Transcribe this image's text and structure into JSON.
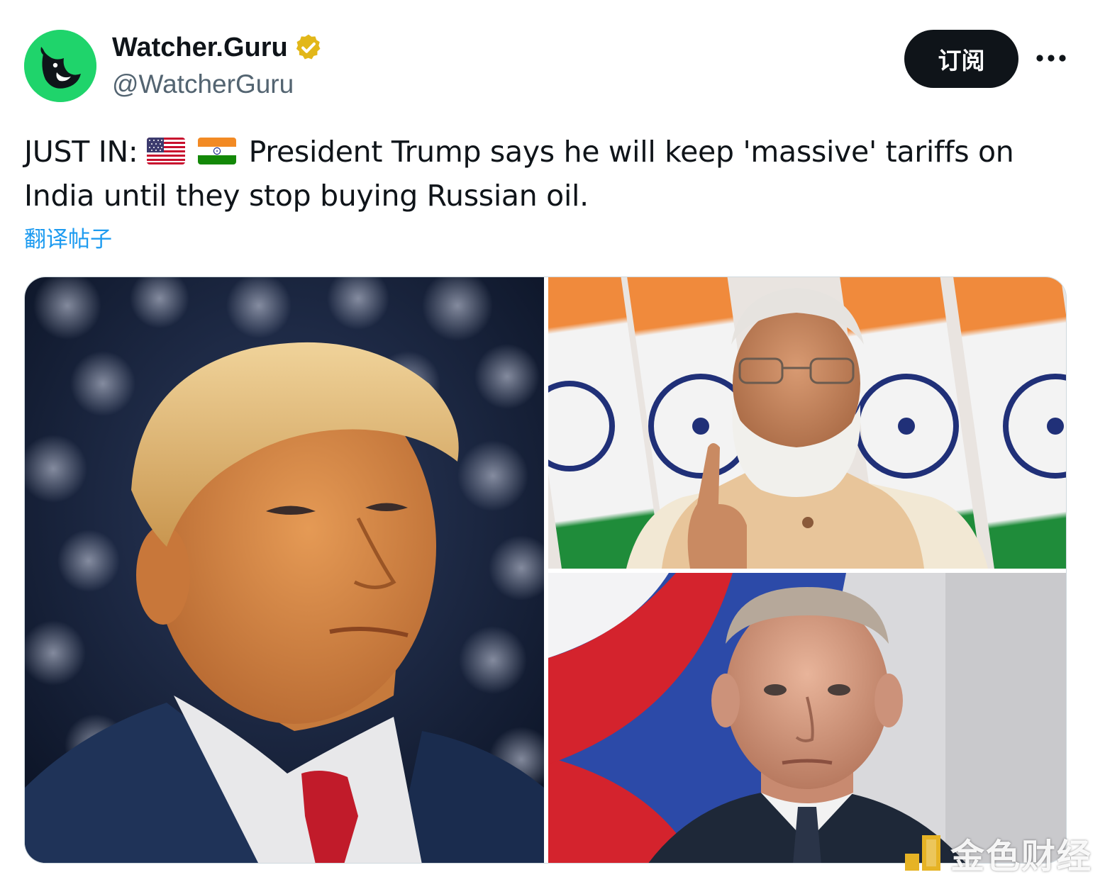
{
  "author": {
    "display_name": "Watcher.Guru",
    "handle": "@WatcherGuru",
    "verified": true,
    "avatar_icon": "whale-logo-icon",
    "avatar_color": "#1fd46b"
  },
  "actions": {
    "subscribe_label": "订阅",
    "more_icon": "more-horizontal-icon"
  },
  "tweet": {
    "prefix": "JUST IN:",
    "flags": [
      "us-flag-icon",
      "india-flag-icon"
    ],
    "body": "President Trump says he will keep 'massive' tariffs on India until they stop buying Russian oil.",
    "translate_label": "翻译帖子"
  },
  "media": {
    "photos": [
      {
        "icon": "trump-photo-icon"
      },
      {
        "icon": "modi-photo-icon"
      },
      {
        "icon": "putin-photo-icon"
      }
    ]
  },
  "watermark": {
    "text": "金色财经",
    "icon": "jinse-logo-icon"
  },
  "colors": {
    "text_primary": "#0f1419",
    "text_secondary": "#536471",
    "link": "#1d9bf0",
    "verified_badge": "#e2b719",
    "button_bg": "#0f1419"
  }
}
